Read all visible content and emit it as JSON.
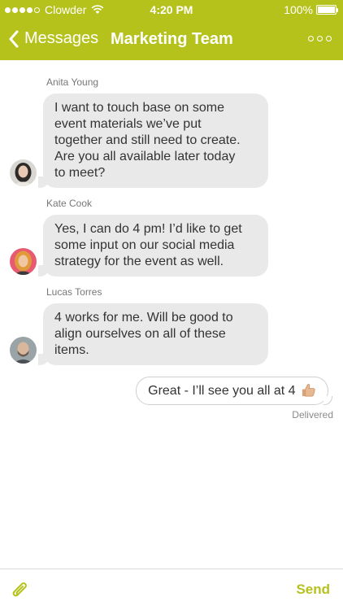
{
  "status": {
    "carrier": "Clowder",
    "time": "4:20 PM",
    "battery": "100%",
    "signal_bars": 5,
    "signal_filled": 4,
    "battery_level": 1.0
  },
  "nav": {
    "back_label": "Messages",
    "title": "Marketing Team"
  },
  "messages": [
    {
      "sender": "Anita Young",
      "text": "I want to touch base on some\nevent materials we’ve put\ntogether and still need to create.\nAre you all available later today\nto meet?"
    },
    {
      "sender": "Kate Cook",
      "text": "Yes, I can do 4 pm! I’d like to get\nsome input on our social media\nstrategy for the event as well."
    },
    {
      "sender": "Lucas Torres",
      "text": "4 works for me. Will be good to\nalign ourselves on all of these\nitems."
    }
  ],
  "outgoing": {
    "text": "Great - I’ll see you all at 4",
    "emoji_icon": "thumbs-up-icon",
    "status": "Delivered"
  },
  "composer": {
    "input_value": "",
    "send_label": "Send",
    "attach_icon": "paperclip-icon"
  },
  "colors": {
    "accent": "#b6c21c",
    "bubble_incoming": "#e9e9ea"
  }
}
